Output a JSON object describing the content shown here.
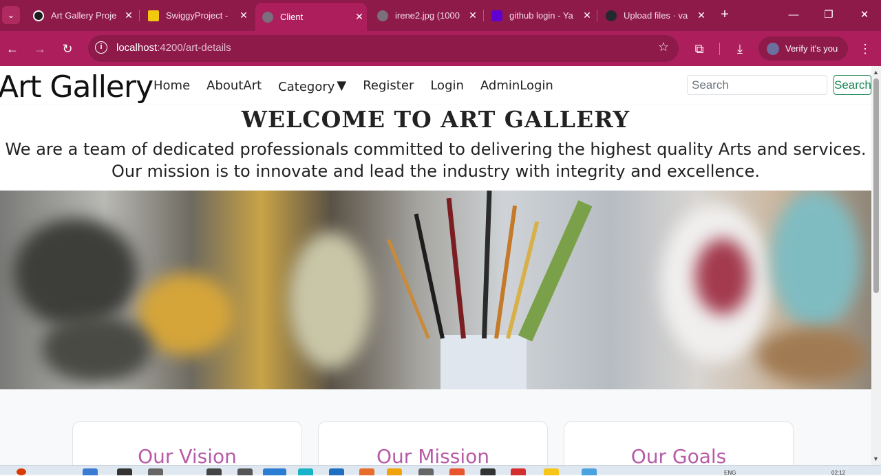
{
  "browser": {
    "tabs": [
      {
        "title": "Art Gallery Proje",
        "active": false
      },
      {
        "title": "SwiggyProject -",
        "active": false
      },
      {
        "title": "Client",
        "active": true
      },
      {
        "title": "irene2.jpg (1000",
        "active": false
      },
      {
        "title": "github login - Ya",
        "active": false
      },
      {
        "title": "Upload files · va",
        "active": false
      }
    ],
    "url_host": "localhost",
    "url_path": ":4200/art-details",
    "profile_label": "Verify it's you"
  },
  "navbar": {
    "brand": "Art Gallery",
    "links": [
      "Home",
      "AboutArt",
      "Category",
      "Register",
      "Login",
      "AdminLogin"
    ],
    "search_placeholder": "Search",
    "search_button": "Search"
  },
  "welcome": {
    "heading": "WELCOME TO ART GALLERY",
    "line1": "We are a team of dedicated professionals committed to delivering the highest quality Arts and services.",
    "line2": "Our mission is to innovate and lead the industry with integrity and excellence."
  },
  "cards": [
    "Our Vision",
    "Our Mission",
    "Our Goals"
  ],
  "taskbar": {
    "lang": "ENG",
    "time": "02:12"
  },
  "colors": {
    "chrome_dark": "#8e1a4a",
    "chrome": "#ad1f5c",
    "card_title": "#b85aa6",
    "search_button": "#198754"
  }
}
